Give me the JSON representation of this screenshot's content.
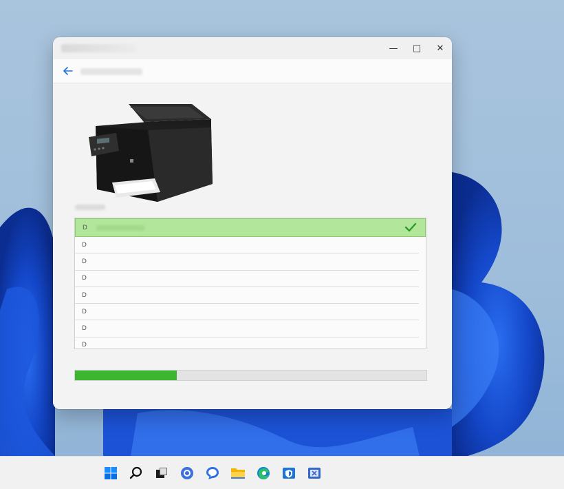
{
  "window": {
    "title": "",
    "nav_title": "",
    "controls": {
      "minimize": "—",
      "maximize": "□",
      "close": "✕"
    }
  },
  "device": {
    "image": "printer-image"
  },
  "list": {
    "rows": [
      {
        "label": "D",
        "selected": true,
        "status_icon": "checkmark-icon"
      },
      {
        "label": "D",
        "selected": false
      },
      {
        "label": "D",
        "selected": false
      },
      {
        "label": "D",
        "selected": false
      },
      {
        "label": "D",
        "selected": false
      },
      {
        "label": "D",
        "selected": false
      },
      {
        "label": "D",
        "selected": false
      },
      {
        "label": "D",
        "selected": false
      }
    ]
  },
  "progress": {
    "value": 0.29
  },
  "taskbar": {
    "icons": [
      "windows-start-icon",
      "search-icon",
      "task-view-icon",
      "teams-icon",
      "chat-icon",
      "file-explorer-icon",
      "edge-icon",
      "security-icon",
      "store-icon"
    ]
  },
  "colors": {
    "accent_green": "#3cb531",
    "selected_row": "#b2e69a",
    "check": "#2e9a2a",
    "back_arrow": "#1a73d9"
  }
}
